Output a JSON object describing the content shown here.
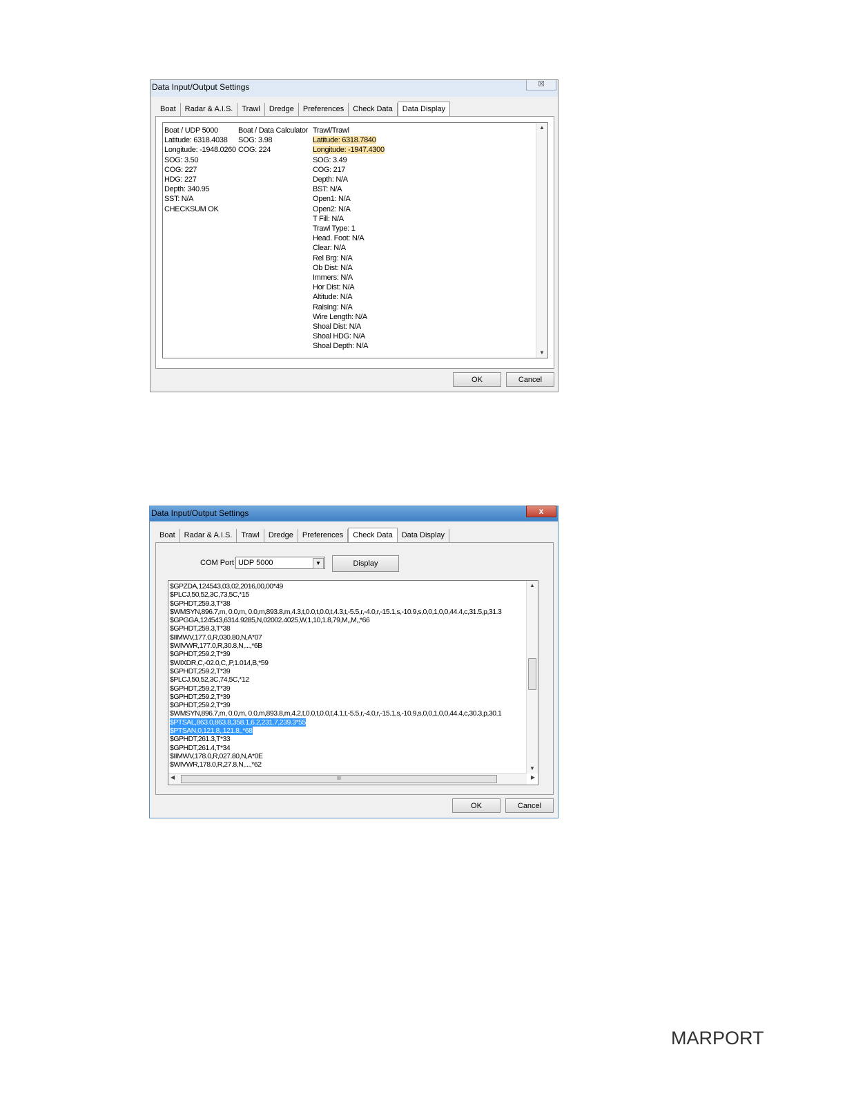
{
  "dialog1": {
    "title": "Data Input/Output Settings",
    "close_glyph": "☒",
    "tabs": [
      "Boat",
      "Radar & A.I.S.",
      "Trawl",
      "Dredge",
      "Preferences",
      "Check Data",
      "Data Display"
    ],
    "active_tab": "Data Display",
    "col1": [
      "Boat / UDP 5000",
      "Latitude: 6318.4038",
      "Longitude: -1948.0260",
      "SOG:    3.50",
      "COG:   227",
      "HDG:   227",
      "Depth:   340.95",
      "SST: N/A",
      "CHECKSUM OK"
    ],
    "col2": [
      "Boat / Data Calculator",
      "SOG:    3.98",
      "COG:    224"
    ],
    "col3": [
      "Trawl/Trawl",
      "Latitude: 6318.7840",
      "Longitude: -1947.4300",
      "SOG:    3.49",
      "COG:   217",
      "Depth: N/A",
      "BST: N/A",
      "Open1: N/A",
      "Open2: N/A",
      "T Fill: N/A",
      "Trawl Type:   1",
      "Head. Foot: N/A",
      "Clear: N/A",
      "Rel Brg: N/A",
      "Ob Dist: N/A",
      "Immers: N/A",
      "Hor Dist: N/A",
      "Altitude: N/A",
      "Raising: N/A",
      "Wire Length: N/A",
      "Shoal Dist: N/A",
      "Shoal HDG: N/A",
      "Shoal Depth: N/A"
    ],
    "ok": "OK",
    "cancel": "Cancel"
  },
  "dialog2": {
    "title": "Data Input/Output Settings",
    "close_glyph": "x",
    "tabs": [
      "Boat",
      "Radar & A.I.S.",
      "Trawl",
      "Dredge",
      "Preferences",
      "Check Data",
      "Data Display"
    ],
    "active_tab": "Check Data",
    "com_port_label": "COM Port",
    "com_port_value": "UDP 5000",
    "display_button": "Display",
    "nmea_lines": [
      "$GPZDA,124543,03,02,2016,00,00*49",
      "$PLCJ,50,52,3C,73,5C,*15",
      "$GPHDT,259.3,T*38",
      "$WMSYN,896.7,m, 0.0,m, 0.0,m,893.8,m,4.3,t,0.0,t,0.0,t,4.3,t,-5.5,r,-4.0,r,-15.1,s,-10.9,s,0,0,1,0,0,44.4,c,31.5,p,31.3",
      "$GPGGA,124543,6314.9285,N,02002.4025,W,1,10,1.8,79,M,,M,,*66",
      "$GPHDT,259.3,T*38",
      "$IIMWV,177.0,R,030.80,N,A*07",
      "$WIVWR,177.0,R,30.8,N,...,*6B",
      "$GPHDT,259.2,T*39",
      "$WIXDR,C,-02.0,C,,P,1.014,B,*59",
      "$GPHDT,259.2,T*39",
      "$PLCJ,50,52,3C,74,5C,*12",
      "$GPHDT,259.2,T*39",
      "$GPHDT,259.2,T*39",
      "$GPHDT,259.2,T*39",
      "$WMSYN,896.7,m, 0.0,m, 0.0,m,893.8,m,4.2,t,0.0,t,0.0,t,4.1,t,-5.5,r,-4.0,r,-15.1,s,-10.9,s,0,0,1,0,0,44.4,c,30.3,p,30.1",
      "$PTSAL,863.0,863.8,358.1,6.2,231.7,239.3*55",
      "$PTSAN,0,121.8,,121.8,,*68",
      "$GPHDT,261.3,T*33",
      "$GPHDT,261.4,T*34",
      "$IIMWV,178.0,R,027.80,N,A*0E",
      "$WIVWR,178.0,R,27.8,N,...,*62"
    ],
    "selected_lines": [
      16,
      17
    ],
    "hscroll_mid": "III",
    "ok": "OK",
    "cancel": "Cancel"
  },
  "logo_text": "MARPORT"
}
